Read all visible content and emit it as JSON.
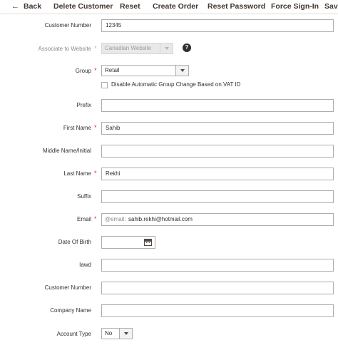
{
  "toolbar": {
    "back": "Back",
    "delete": "Delete Customer",
    "reset": "Reset",
    "create_order": "Create Order",
    "reset_password": "Reset Password",
    "force_signin": "Force Sign-In",
    "save": "Save"
  },
  "form": {
    "customer_number_top": {
      "label": "Customer Number",
      "value": "12345"
    },
    "website": {
      "label": "Associate to Website",
      "value": "Canadian Website"
    },
    "group": {
      "label": "Group",
      "value": "Retail"
    },
    "vat": {
      "label": "Disable Automatic Group Change Based on VAT ID"
    },
    "prefix": {
      "label": "Prefix",
      "value": ""
    },
    "first_name": {
      "label": "First Name",
      "value": "Sahib"
    },
    "middle_name": {
      "label": "Middle Name/Initial",
      "value": ""
    },
    "last_name": {
      "label": "Last Name",
      "value": "Rekhi"
    },
    "suffix": {
      "label": "Suffix",
      "value": ""
    },
    "email": {
      "label": "Email",
      "addon": "@email:",
      "value": "sahib.rekhi@hotmail.com"
    },
    "dob": {
      "label": "Date Of Birth",
      "value": ""
    },
    "iawd": {
      "label": "Iawd",
      "value": ""
    },
    "customer_number": {
      "label": "Customer Number",
      "value": ""
    },
    "company_name": {
      "label": "Company Name",
      "value": ""
    },
    "account_type": {
      "label": "Account Type",
      "value": "No"
    }
  },
  "required_mark": "*",
  "help_glyph": "?",
  "icons": [
    "back-arrow-icon",
    "help-icon",
    "chevron-down-icon",
    "calendar-icon"
  ]
}
